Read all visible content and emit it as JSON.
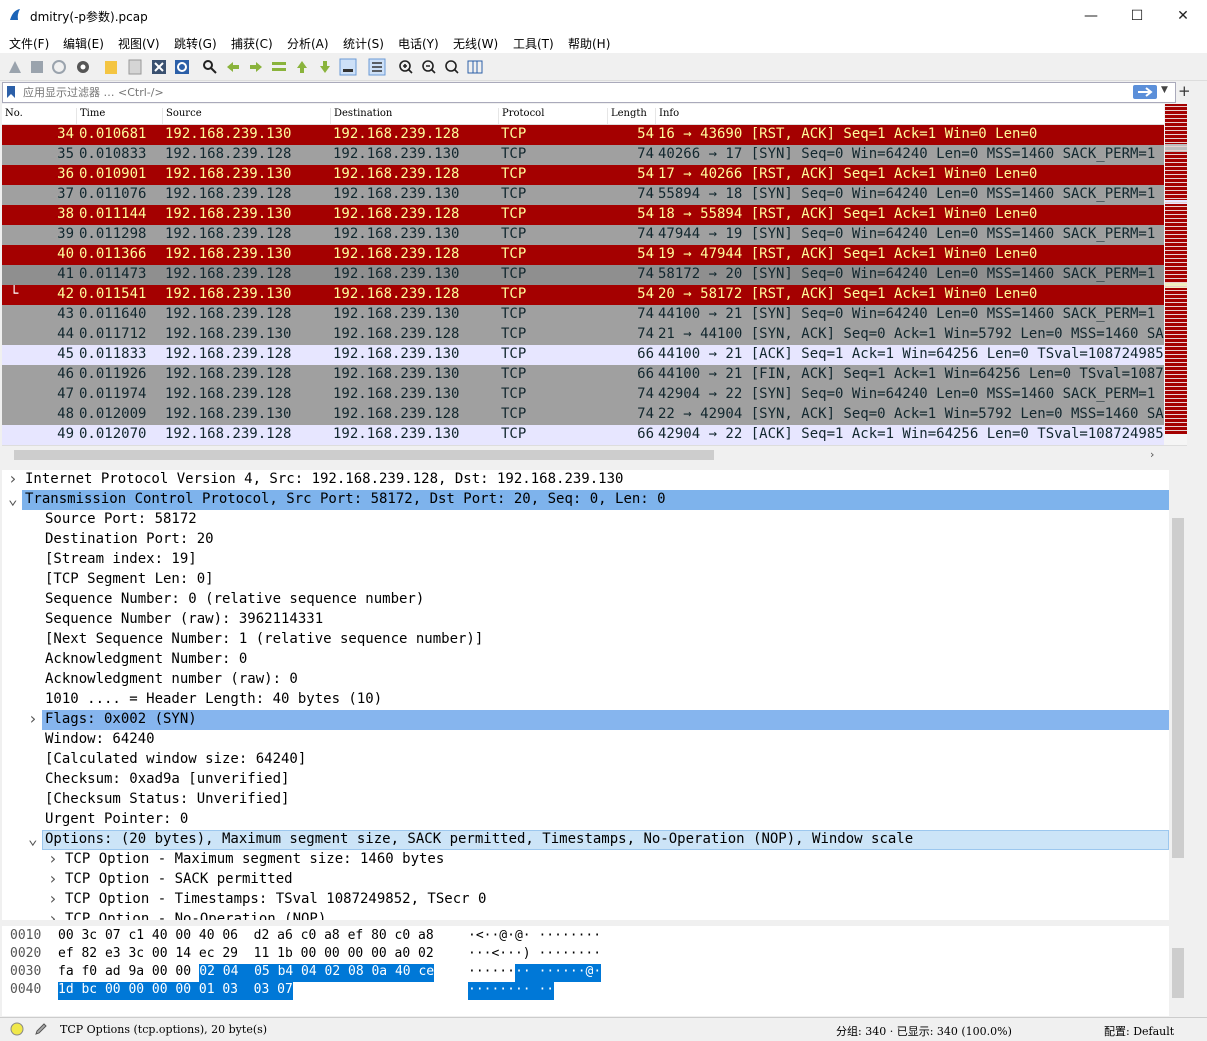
{
  "window": {
    "title": "dmitry(-p参数).pcap"
  },
  "menu": [
    "文件(F)",
    "编辑(E)",
    "视图(V)",
    "跳转(G)",
    "捕获(C)",
    "分析(A)",
    "统计(S)",
    "电话(Y)",
    "无线(W)",
    "工具(T)",
    "帮助(H)"
  ],
  "filter": {
    "placeholder": "应用显示过滤器 … <Ctrl-/>"
  },
  "columns": [
    "No.",
    "Time",
    "Source",
    "Destination",
    "Protocol",
    "Length",
    "Info"
  ],
  "packets": [
    {
      "no": "34",
      "time": "0.010681",
      "src": "192.168.239.130",
      "dst": "192.168.239.128",
      "proto": "TCP",
      "len": "54",
      "info": "16 → 43690 [RST, ACK] Seq=1 Ack=1 Win=0 Len=0",
      "style": "rst"
    },
    {
      "no": "35",
      "time": "0.010833",
      "src": "192.168.239.128",
      "dst": "192.168.239.130",
      "proto": "TCP",
      "len": "74",
      "info": "40266 → 17 [SYN] Seq=0 Win=64240 Len=0 MSS=1460 SACK_PERM=1 TSv",
      "style": "gray"
    },
    {
      "no": "36",
      "time": "0.010901",
      "src": "192.168.239.130",
      "dst": "192.168.239.128",
      "proto": "TCP",
      "len": "54",
      "info": "17 → 40266 [RST, ACK] Seq=1 Ack=1 Win=0 Len=0",
      "style": "rst"
    },
    {
      "no": "37",
      "time": "0.011076",
      "src": "192.168.239.128",
      "dst": "192.168.239.130",
      "proto": "TCP",
      "len": "74",
      "info": "55894 → 18 [SYN] Seq=0 Win=64240 Len=0 MSS=1460 SACK_PERM=1 TSv",
      "style": "gray"
    },
    {
      "no": "38",
      "time": "0.011144",
      "src": "192.168.239.130",
      "dst": "192.168.239.128",
      "proto": "TCP",
      "len": "54",
      "info": "18 → 55894 [RST, ACK] Seq=1 Ack=1 Win=0 Len=0",
      "style": "rst"
    },
    {
      "no": "39",
      "time": "0.011298",
      "src": "192.168.239.128",
      "dst": "192.168.239.130",
      "proto": "TCP",
      "len": "74",
      "info": "47944 → 19 [SYN] Seq=0 Win=64240 Len=0 MSS=1460 SACK_PERM=1 TSv",
      "style": "gray"
    },
    {
      "no": "40",
      "time": "0.011366",
      "src": "192.168.239.130",
      "dst": "192.168.239.128",
      "proto": "TCP",
      "len": "54",
      "info": "19 → 47944 [RST, ACK] Seq=1 Ack=1 Win=0 Len=0",
      "style": "rst"
    },
    {
      "no": "41",
      "time": "0.011473",
      "src": "192.168.239.128",
      "dst": "192.168.239.130",
      "proto": "TCP",
      "len": "74",
      "info": "58172 → 20 [SYN] Seq=0 Win=64240 Len=0 MSS=1460 SACK_PERM=1 TSv",
      "style": "gray sel"
    },
    {
      "no": "42",
      "time": "0.011541",
      "src": "192.168.239.130",
      "dst": "192.168.239.128",
      "proto": "TCP",
      "len": "54",
      "info": "20 → 58172 [RST, ACK] Seq=1 Ack=1 Win=0 Len=0",
      "style": "rst"
    },
    {
      "no": "43",
      "time": "0.011640",
      "src": "192.168.239.128",
      "dst": "192.168.239.130",
      "proto": "TCP",
      "len": "74",
      "info": "44100 → 21 [SYN] Seq=0 Win=64240 Len=0 MSS=1460 SACK_PERM=1 TSv",
      "style": "gray"
    },
    {
      "no": "44",
      "time": "0.011712",
      "src": "192.168.239.130",
      "dst": "192.168.239.128",
      "proto": "TCP",
      "len": "74",
      "info": "21 → 44100 [SYN, ACK] Seq=0 Ack=1 Win=5792 Len=0 MSS=1460 SACK_",
      "style": "gray"
    },
    {
      "no": "45",
      "time": "0.011833",
      "src": "192.168.239.128",
      "dst": "192.168.239.130",
      "proto": "TCP",
      "len": "66",
      "info": "44100 → 21 [ACK] Seq=1 Ack=1 Win=64256 Len=0 TSval=1087249852 T",
      "style": "lav"
    },
    {
      "no": "46",
      "time": "0.011926",
      "src": "192.168.239.128",
      "dst": "192.168.239.130",
      "proto": "TCP",
      "len": "66",
      "info": "44100 → 21 [FIN, ACK] Seq=1 Ack=1 Win=64256 Len=0 TSval=1087249",
      "style": "gray"
    },
    {
      "no": "47",
      "time": "0.011974",
      "src": "192.168.239.128",
      "dst": "192.168.239.130",
      "proto": "TCP",
      "len": "74",
      "info": "42904 → 22 [SYN] Seq=0 Win=64240 Len=0 MSS=1460 SACK_PERM=1 TSv",
      "style": "gray"
    },
    {
      "no": "48",
      "time": "0.012009",
      "src": "192.168.239.130",
      "dst": "192.168.239.128",
      "proto": "TCP",
      "len": "74",
      "info": "22 → 42904 [SYN, ACK] Seq=0 Ack=1 Win=5792 Len=0 MSS=1460 SACK_",
      "style": "gray"
    },
    {
      "no": "49",
      "time": "0.012070",
      "src": "192.168.239.128",
      "dst": "192.168.239.130",
      "proto": "TCP",
      "len": "66",
      "info": "42904 → 22 [ACK] Seq=1 Ack=1 Win=64256 Len=0 TSval=1087249852 T",
      "style": "lav"
    }
  ],
  "details": [
    {
      "arrow": ">",
      "indent": 0,
      "text": "Internet Protocol Version 4, Src: 192.168.239.128, Dst: 192.168.239.130",
      "hl": ""
    },
    {
      "arrow": "v",
      "indent": 0,
      "text": "Transmission Control Protocol, Src Port: 58172, Dst Port: 20, Seq: 0, Len: 0",
      "hl": "strong"
    },
    {
      "arrow": "",
      "indent": 1,
      "text": "Source Port: 58172",
      "hl": ""
    },
    {
      "arrow": "",
      "indent": 1,
      "text": "Destination Port: 20",
      "hl": ""
    },
    {
      "arrow": "",
      "indent": 1,
      "text": "[Stream index: 19]",
      "hl": ""
    },
    {
      "arrow": "",
      "indent": 1,
      "text": "[TCP Segment Len: 0]",
      "hl": ""
    },
    {
      "arrow": "",
      "indent": 1,
      "text": "Sequence Number: 0    (relative sequence number)",
      "hl": ""
    },
    {
      "arrow": "",
      "indent": 1,
      "text": "Sequence Number (raw): 3962114331",
      "hl": ""
    },
    {
      "arrow": "",
      "indent": 1,
      "text": "[Next Sequence Number: 1    (relative sequence number)]",
      "hl": ""
    },
    {
      "arrow": "",
      "indent": 1,
      "text": "Acknowledgment Number: 0",
      "hl": ""
    },
    {
      "arrow": "",
      "indent": 1,
      "text": "Acknowledgment number (raw): 0",
      "hl": ""
    },
    {
      "arrow": "",
      "indent": 1,
      "text": "1010 .... = Header Length: 40 bytes (10)",
      "hl": ""
    },
    {
      "arrow": ">",
      "indent": 1,
      "text": "Flags: 0x002 (SYN)",
      "hl": "mid"
    },
    {
      "arrow": "",
      "indent": 1,
      "text": "Window: 64240",
      "hl": ""
    },
    {
      "arrow": "",
      "indent": 1,
      "text": "[Calculated window size: 64240]",
      "hl": ""
    },
    {
      "arrow": "",
      "indent": 1,
      "text": "Checksum: 0xad9a [unverified]",
      "hl": ""
    },
    {
      "arrow": "",
      "indent": 1,
      "text": "[Checksum Status: Unverified]",
      "hl": ""
    },
    {
      "arrow": "",
      "indent": 1,
      "text": "Urgent Pointer: 0",
      "hl": ""
    },
    {
      "arrow": "v",
      "indent": 1,
      "text": "Options: (20 bytes), Maximum segment size, SACK permitted, Timestamps, No-Operation (NOP), Window scale",
      "hl": "light"
    },
    {
      "arrow": ">",
      "indent": 2,
      "text": "TCP Option - Maximum segment size: 1460 bytes",
      "hl": ""
    },
    {
      "arrow": ">",
      "indent": 2,
      "text": "TCP Option - SACK permitted",
      "hl": ""
    },
    {
      "arrow": ">",
      "indent": 2,
      "text": "TCP Option - Timestamps: TSval 1087249852, TSecr 0",
      "hl": ""
    },
    {
      "arrow": ">",
      "indent": 2,
      "text": "TCP Option - No-Operation (NOP)",
      "hl": ""
    }
  ],
  "hex": [
    {
      "offset": "0010",
      "hex_a": "00 3c 07 c1 40 00 40 06  d2 a6 c0 a8 ef 80 c0 a8",
      "hex_hl": "",
      "ascii_a": "·<··@·@· ········",
      "ascii_hl": ""
    },
    {
      "offset": "0020",
      "hex_a": "ef 82 e3 3c 00 14 ec 29  11 1b 00 00 00 00 a0 02",
      "hex_hl": "",
      "ascii_a": "···<···) ········",
      "ascii_hl": ""
    },
    {
      "offset": "0030",
      "hex_a": "fa f0 ad 9a 00 00 ",
      "hex_hl": "02 04  05 b4 04 02 08 0a 40 ce",
      "ascii_a": "······",
      "ascii_hl": "·· ······@·"
    },
    {
      "offset": "0040",
      "hex_a": "",
      "hex_hl": "1d bc 00 00 00 00 01 03  03 07",
      "ascii_a": "",
      "ascii_hl": "········ ··"
    }
  ],
  "status": {
    "field": "TCP Options (tcp.options), 20 byte(s)",
    "packets": "分组: 340 · 已显示: 340 (100.0%)",
    "profile": "配置: Default"
  },
  "colors": {
    "rst_bg": "#a40000",
    "rst_fg": "#fffc9c",
    "gray_bg": "#a0a0a0",
    "lav_bg": "#e7e6ff",
    "select": "#0078d7"
  }
}
